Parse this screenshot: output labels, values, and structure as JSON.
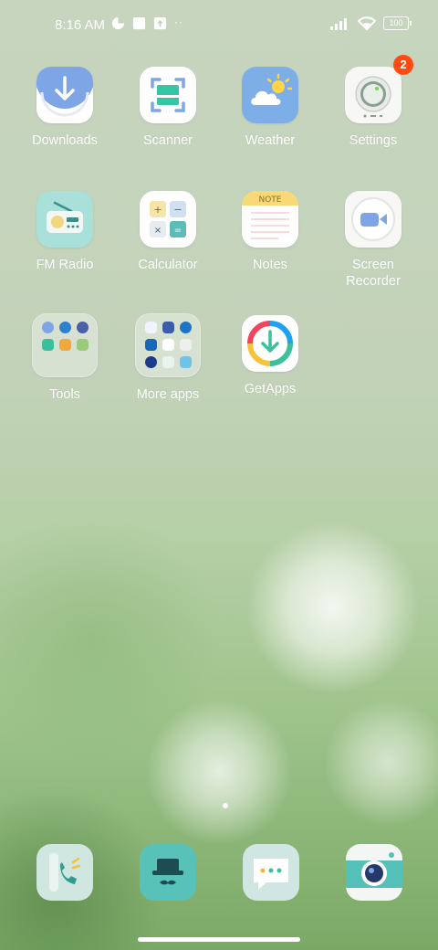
{
  "status_bar": {
    "time": "8:16 AM",
    "battery": "100"
  },
  "apps": [
    {
      "label": "Downloads"
    },
    {
      "label": "Scanner"
    },
    {
      "label": "Weather"
    },
    {
      "label": "Settings",
      "badge": "2"
    },
    {
      "label": "FM Radio"
    },
    {
      "label": "Calculator"
    },
    {
      "label": "Notes",
      "header": "NOTE"
    },
    {
      "label": "Screen\nRecorder"
    },
    {
      "label": "Tools"
    },
    {
      "label": "More apps"
    },
    {
      "label": "GetApps"
    }
  ],
  "dock": [
    {
      "name": "phone-icon"
    },
    {
      "name": "browser-icon"
    },
    {
      "name": "messages-icon"
    },
    {
      "name": "camera-icon"
    }
  ],
  "colors": {
    "badge": "#ff4a14",
    "accent_teal": "#2a8f8c"
  }
}
